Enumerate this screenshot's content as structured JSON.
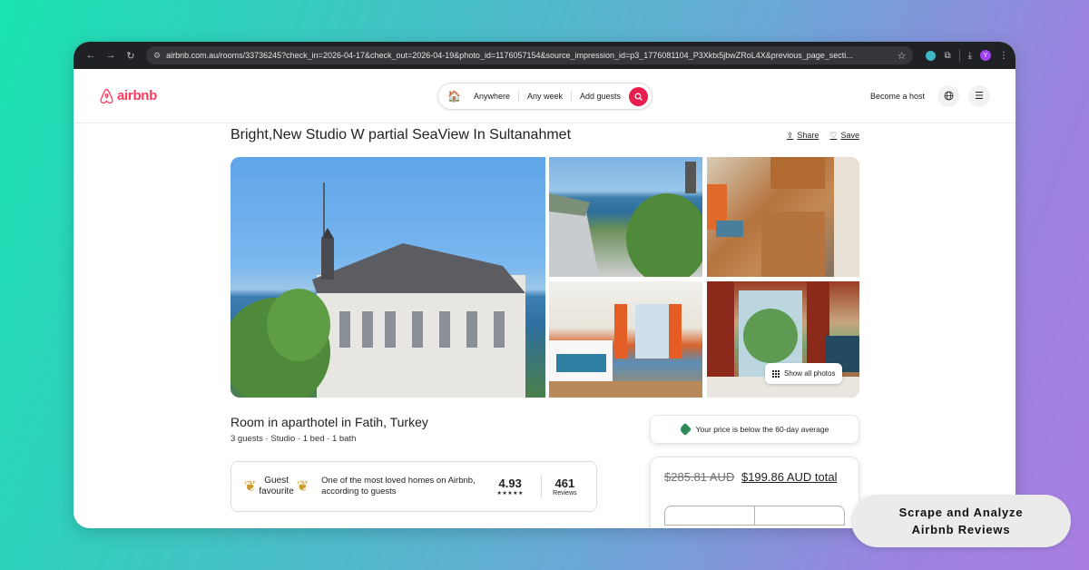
{
  "browser": {
    "url": "airbnb.com.au/rooms/33736245?check_in=2026-04-17&check_out=2026-04-19&photo_id=1176057154&source_impression_id=p3_1776081104_P3Xktx5jbwZRoL4X&previous_page_secti...",
    "avatar_letter": "Y"
  },
  "header": {
    "logo_text": "airbnb",
    "search": {
      "where": "Anywhere",
      "when": "Any week",
      "who": "Add guests"
    },
    "become_host": "Become a host"
  },
  "listing": {
    "title": "Bright,New Studio W partial SeaView In Sultanahmet",
    "share_label": "Share",
    "save_label": "Save",
    "show_all_photos": "Show all photos",
    "room_type": "Room in aparthotel in Fatih, Turkey",
    "details": "3 guests · Studio · 1 bed · 1 bath",
    "guest_favourite": {
      "label_line1": "Guest",
      "label_line2": "favourite",
      "description": "One of the most loved homes on Airbnb, according to guests",
      "rating": "4.93",
      "stars": "★★★★★",
      "reviews_count": "461",
      "reviews_label": "Reviews"
    }
  },
  "booking": {
    "price_note": "Your price is below the 60-day average",
    "old_price": "$285.81 AUD",
    "new_price": "$199.86 AUD total"
  },
  "badge": {
    "line1": "Scrape and Analyze",
    "line2": "Airbnb Reviews"
  },
  "colors": {
    "brand": "#ff385c",
    "search_button": "#e61e4d",
    "price_tag": "#2e8b57"
  }
}
